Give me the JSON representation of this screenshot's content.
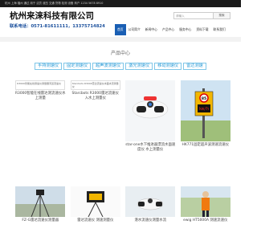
{
  "topbar": {
    "text": "杭州 上海 福州 通过 用于 洁员 液压 交通 货物 检测 设备 商户 1234 5678 8910"
  },
  "header": {
    "brand_name": "杭州来涞科技有限公司",
    "phone": "联系电话：0571-81611111，13375714824",
    "search_placeholder": "请输入",
    "search_button": "搜索"
  },
  "nav": {
    "items": [
      "首页",
      "公司简介",
      "新闻中心",
      "产品中心",
      "服务中心",
      "资料下载",
      "联系我们"
    ],
    "active_index": 0
  },
  "section_title": "产品中心",
  "categories": [
    "手持测速仪",
    "固定测速仪",
    "超声波测速仪",
    "激光测速仪",
    "移动测速仪",
    "雷达测速"
  ],
  "products_row1": [
    {
      "alt": "R3000智能在线测速仪测量器河道流速仪",
      "caption": "R3000智能在线雷达测流速仪水上测量"
    },
    {
      "alt": "Starcbots R3000雷达流速仪水面水流测量仪",
      "caption": "Starcbots R3000雷达流速仪 入水上测量仪"
    },
    {
      "alt": "",
      "caption": "star-one水下推进器漂流水面速度仪 水上测量仪"
    },
    {
      "alt": "",
      "caption": "HK771固定超声波测速流速仪"
    }
  ],
  "products_row2": [
    {
      "caption": "FZ-G雷达流速仪测量器"
    },
    {
      "caption": "雷达流速仪 测速测量仪"
    },
    {
      "caption": "港水流速仪测量水流"
    },
    {
      "caption": "ewig HT5000A 测速流速仪"
    }
  ],
  "sign": {
    "label": "85",
    "unit": "km/h"
  }
}
